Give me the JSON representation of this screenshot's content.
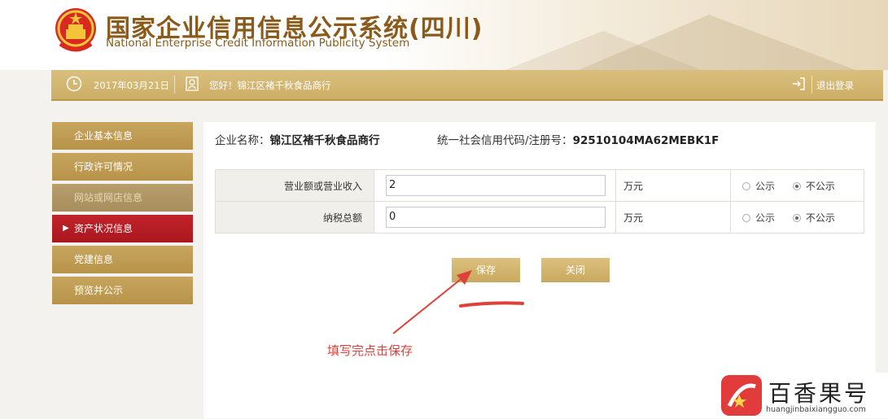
{
  "header": {
    "title_cn": "国家企业信用信息公示系统(四川)",
    "title_en": "National Enterprise Credit Information Publicity System",
    "emblem_icon": "national-emblem-icon"
  },
  "topbar": {
    "date": "2017年03月21日",
    "greeting": "您好！锦江区褚千秋食品商行",
    "logout": "退出登录"
  },
  "sidebar": {
    "items": [
      {
        "label": "企业基本信息",
        "state": "normal"
      },
      {
        "label": "行政许可情况",
        "state": "normal"
      },
      {
        "label": "网站或网店信息",
        "state": "disabled"
      },
      {
        "label": "资产状况信息",
        "state": "active"
      },
      {
        "label": "党建信息",
        "state": "normal"
      },
      {
        "label": "预览并公示",
        "state": "normal"
      }
    ]
  },
  "enterprise": {
    "name_label": "企业名称：",
    "name": "锦江区褚千秋食品商行",
    "code_label": "统一社会信用代码/注册号：",
    "code": "92510104MA62MEBK1F"
  },
  "form": {
    "rows": [
      {
        "label": "营业额或营业收入",
        "value": "2",
        "unit": "万元",
        "opt_public": "公示",
        "opt_private": "不公示",
        "selected": "不公示"
      },
      {
        "label": "纳税总额",
        "value": "0",
        "unit": "万元",
        "opt_public": "公示",
        "opt_private": "不公示",
        "selected": "不公示"
      }
    ],
    "save_label": "保存",
    "close_label": "关闭"
  },
  "annotation": {
    "text": "填写完点击保存",
    "color": "#e0403a"
  },
  "watermark": {
    "title": "百香果号",
    "url": "huangjinbaixiangguo.com"
  },
  "colors": {
    "gold": "#c9a95f",
    "active_red": "#b71c22",
    "title_brown": "#8a5a1a"
  }
}
